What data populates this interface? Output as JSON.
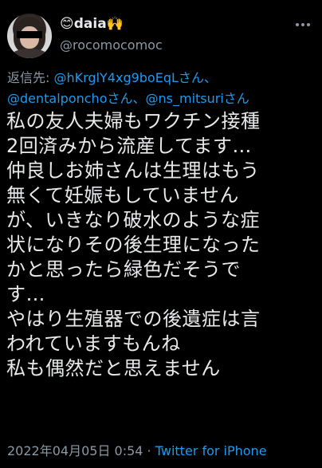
{
  "author": {
    "display_name": "😊daia🙌",
    "handle": "@rocomocomoc"
  },
  "reply": {
    "prefix": "返信先: ",
    "mentions": [
      {
        "handle": "@hKrglY4xg9boEqL",
        "suffix": "さん、"
      },
      {
        "handle": "@dentalponcho",
        "suffix": "さん、"
      },
      {
        "handle": "@ns_mitsuri",
        "suffix": "さん"
      }
    ]
  },
  "tweet": {
    "lines": [
      "私の友人夫婦もワクチン接種",
      "2回済みから流産してます…",
      "仲良しお姉さんは生理はもう",
      "無くて妊娠もしていません",
      "が、いきなり破水のような症",
      "状になりその後生理になった",
      "かと思ったら緑色だそうで",
      "す…",
      "やはり生殖器での後遺症は言",
      "われていますもんね",
      "私も偶然だと思えません"
    ]
  },
  "meta": {
    "timestamp": "2022年04月05日 0:54",
    "separator": " · ",
    "source": "Twitter for iPhone"
  },
  "icons": {
    "more": "more-horizontal-icon"
  },
  "colors": {
    "background": "#000000",
    "text": "#e7e9ea",
    "secondary": "#8b98a5",
    "link": "#1d9bf0"
  }
}
